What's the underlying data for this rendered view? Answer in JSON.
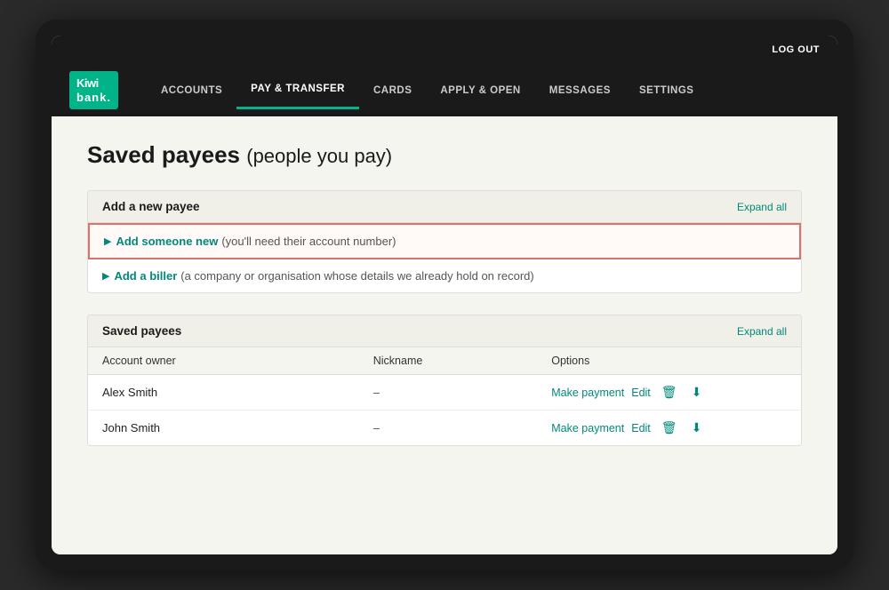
{
  "topbar": {
    "logout_label": "LOG OUT"
  },
  "logo": {
    "line1": "Kiwi",
    "line2": "bank."
  },
  "nav": {
    "items": [
      {
        "label": "ACCOUNTS",
        "active": false
      },
      {
        "label": "PAY & TRANSFER",
        "active": true
      },
      {
        "label": "CARDS",
        "active": false
      },
      {
        "label": "APPLY & OPEN",
        "active": false
      },
      {
        "label": "MESSAGES",
        "active": false
      },
      {
        "label": "SETTINGS",
        "active": false
      }
    ]
  },
  "page": {
    "title": "Saved payees",
    "subtitle": "(people you pay)"
  },
  "add_payee_section": {
    "title": "Add a new payee",
    "expand_all": "Expand all",
    "rows": [
      {
        "link": "Add someone new",
        "helper": "(you'll need their account number)",
        "highlighted": true
      },
      {
        "link": "Add a biller",
        "helper": "(a company or organisation whose details we already hold on record)",
        "highlighted": false
      }
    ]
  },
  "saved_payees_section": {
    "title": "Saved payees",
    "expand_all": "Expand all",
    "columns": [
      "Account owner",
      "Nickname",
      "Options"
    ],
    "rows": [
      {
        "account_owner": "Alex Smith",
        "nickname": "–",
        "options": {
          "make_payment": "Make payment",
          "edit": "Edit"
        }
      },
      {
        "account_owner": "John Smith",
        "nickname": "–",
        "options": {
          "make_payment": "Make payment",
          "edit": "Edit"
        }
      }
    ]
  }
}
